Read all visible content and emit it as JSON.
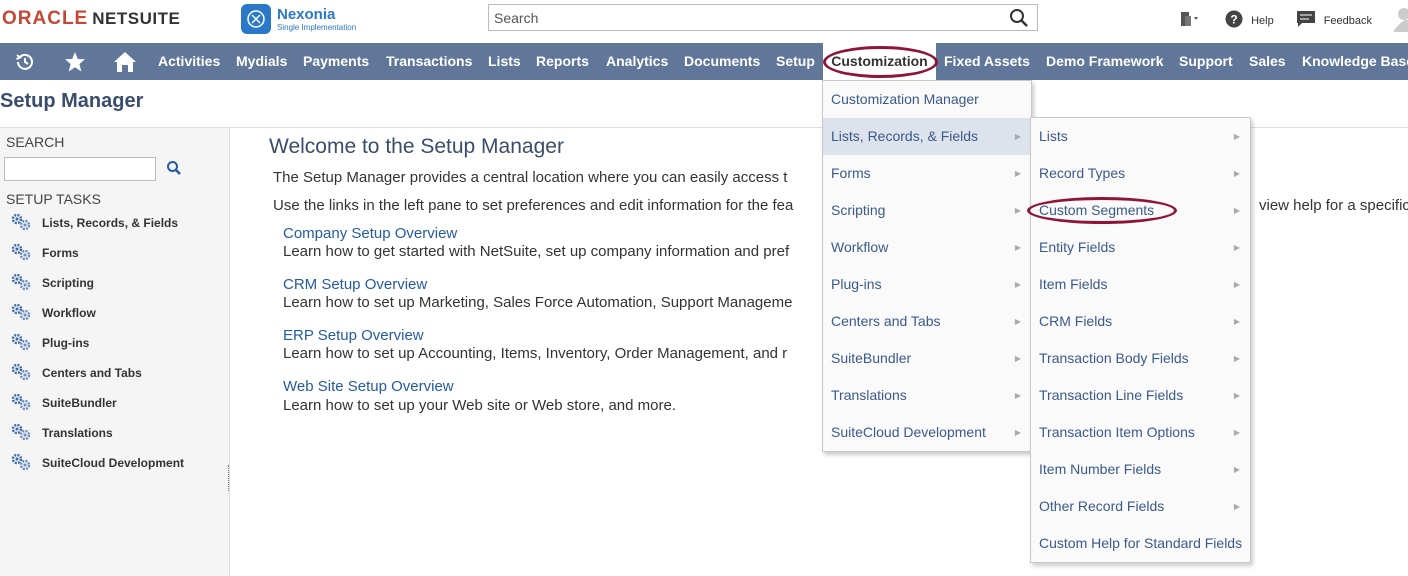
{
  "header": {
    "logo_oracle": "ORACLE",
    "logo_netsuite": "NETSUITE",
    "company_name": "Nexonia",
    "company_sub": "Single Implementation",
    "search_value": "Search",
    "help_label": "Help",
    "feedback_label": "Feedback"
  },
  "nav": {
    "items": [
      "Activities",
      "Mydials",
      "Payments",
      "Transactions",
      "Lists",
      "Reports",
      "Analytics",
      "Documents",
      "Setup",
      "Customization",
      "Fixed Assets",
      "Demo Framework",
      "Support",
      "Sales",
      "Knowledge Base"
    ]
  },
  "page_title": "Setup Manager",
  "left_pane": {
    "search_label": "SEARCH",
    "tasks_label": "SETUP TASKS",
    "tasks": [
      "Lists, Records, & Fields",
      "Forms",
      "Scripting",
      "Workflow",
      "Plug-ins",
      "Centers and Tabs",
      "SuiteBundler",
      "Translations",
      "SuiteCloud Development"
    ]
  },
  "content": {
    "welcome": "Welcome to the Setup Manager",
    "intro1": "The Setup Manager provides a central location where you can easily access t",
    "intro2": "Use the links in the left pane to set preferences and edit information for the fea",
    "sections": [
      {
        "link": "Company Setup Overview",
        "desc": "Learn how to get started with NetSuite, set up company information and pref"
      },
      {
        "link": "CRM Setup Overview",
        "desc": "Learn how to set up Marketing, Sales Force Automation, Support Manageme"
      },
      {
        "link": "ERP Setup Overview",
        "desc": "Learn how to set up Accounting, Items, Inventory, Order Management, and r"
      },
      {
        "link": "Web Site Setup Overview",
        "desc": "Learn how to set up your Web site or Web store, and more."
      }
    ],
    "intro2_tail": "view help for a specific"
  },
  "customization_menu": {
    "items": [
      "Customization Manager",
      "Lists, Records, & Fields",
      "Forms",
      "Scripting",
      "Workflow",
      "Plug-ins",
      "Centers and Tabs",
      "SuiteBundler",
      "Translations",
      "SuiteCloud Development"
    ]
  },
  "lrf_submenu": {
    "items": [
      "Lists",
      "Record Types",
      "Custom Segments",
      "Entity Fields",
      "Item Fields",
      "CRM Fields",
      "Transaction Body Fields",
      "Transaction Line Fields",
      "Transaction Item Options",
      "Item Number Fields",
      "Other Record Fields",
      "Custom Help for Standard Fields"
    ]
  },
  "colors": {
    "navbar": "#607799",
    "highlight_oval": "#8e1538",
    "link": "#255ba3",
    "oracle_red": "#c74634"
  },
  "icons": [
    "recent-icon",
    "star-icon",
    "home-icon",
    "search-icon",
    "gear-icon",
    "help-icon",
    "feedback-icon",
    "user-icon",
    "people-icon"
  ]
}
